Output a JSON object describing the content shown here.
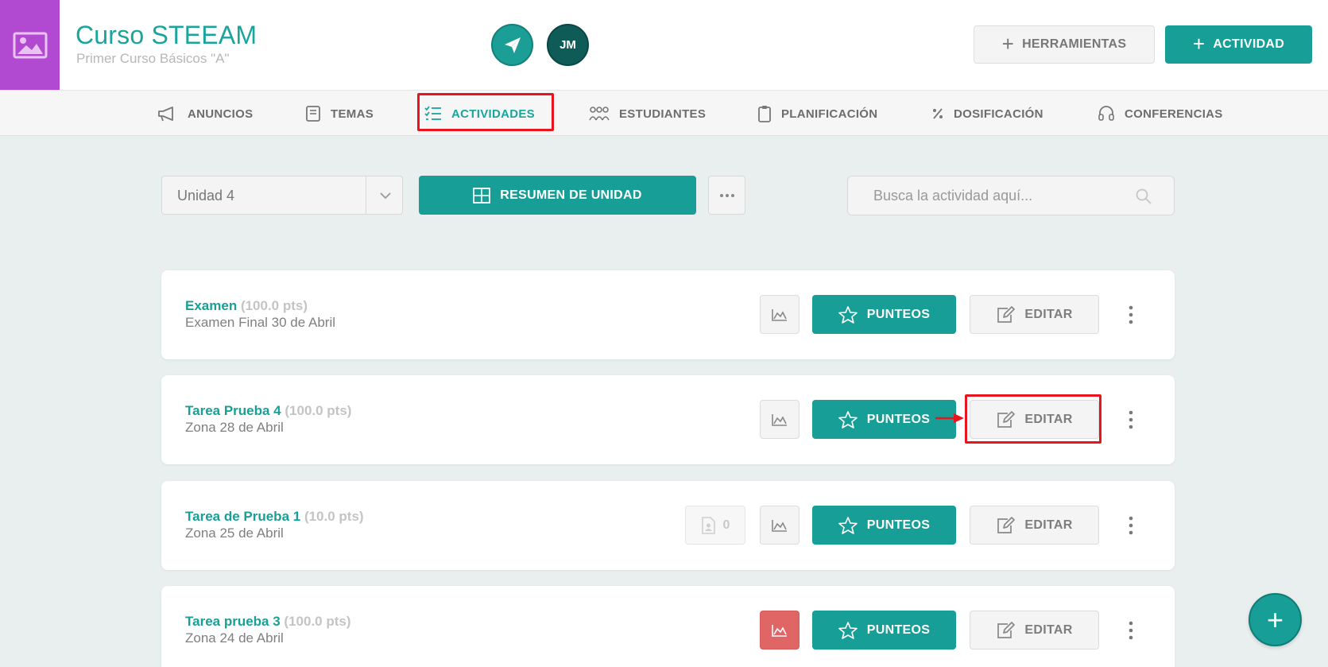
{
  "header": {
    "course_title": "Curso STEEAM",
    "course_subtitle": "Primer Curso Básicos \"A\"",
    "avatar_initials": "JM",
    "tools_label": "HERRAMIENTAS",
    "activity_label": "ACTIVIDAD",
    "logo_color": "#b24ad1",
    "accent_color": "#179e96"
  },
  "nav": {
    "items": [
      {
        "label": "ANUNCIOS",
        "icon": "megaphone-icon"
      },
      {
        "label": "TEMAS",
        "icon": "book-icon"
      },
      {
        "label": "ACTIVIDADES",
        "icon": "checklist-icon",
        "active": true
      },
      {
        "label": "ESTUDIANTES",
        "icon": "students-icon"
      },
      {
        "label": "PLANIFICACIÓN",
        "icon": "clipboard-icon"
      },
      {
        "label": "DOSIFICACIÓN",
        "icon": "percent-icon"
      },
      {
        "label": "CONFERENCIAS",
        "icon": "headset-icon"
      }
    ]
  },
  "toolbar": {
    "unit_value": "Unidad 4",
    "resumen_label": "RESUMEN DE UNIDAD",
    "search_placeholder": "Busca la actividad aquí..."
  },
  "activities": [
    {
      "name": "Examen",
      "points": "(100.0 pts)",
      "subtitle": "Examen Final 30 de Abril",
      "punteos_label": "PUNTEOS",
      "editar_label": "EDITAR"
    },
    {
      "name": "Tarea Prueba 4",
      "points": "(100.0 pts)",
      "subtitle": "Zona 28 de Abril",
      "punteos_label": "PUNTEOS",
      "editar_label": "EDITAR"
    },
    {
      "name": "Tarea de Prueba 1",
      "points": "(10.0 pts)",
      "subtitle": "Zona 25 de Abril",
      "punteos_label": "PUNTEOS",
      "editar_label": "EDITAR",
      "submissions": "0"
    },
    {
      "name": "Tarea prueba 3",
      "points": "(100.0 pts)",
      "subtitle": "Zona 24 de Abril",
      "punteos_label": "PUNTEOS",
      "editar_label": "EDITAR",
      "chart_alert": true
    }
  ],
  "fab_label": "+"
}
